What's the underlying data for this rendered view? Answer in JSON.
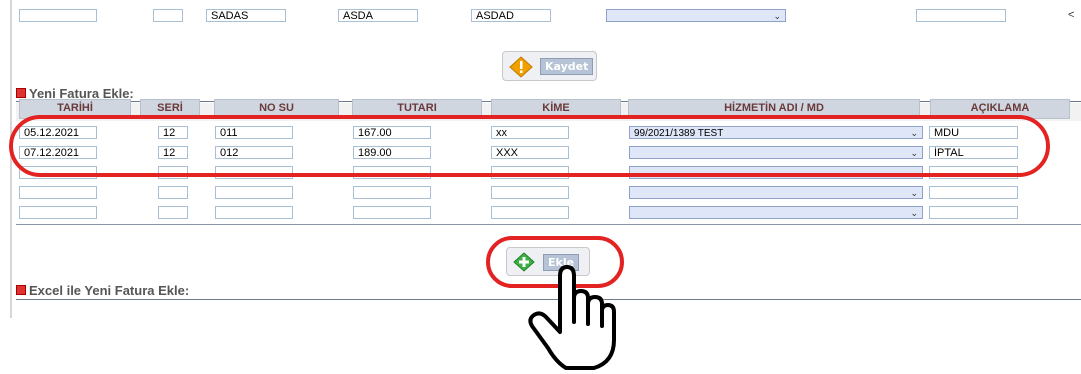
{
  "top_row": {
    "cells": [
      "",
      "",
      "SADAS",
      "ASDA",
      "ASDAD",
      "",
      ""
    ],
    "chevron": "⌄",
    "right_arrow": "<"
  },
  "kaydet_button": {
    "label": "Kaydet",
    "icon": "warning-diamond-icon",
    "icon_color": "#f0a000"
  },
  "yeni_fatura": {
    "title": "Yeni Fatura Ekle:",
    "headers": [
      "TARİHİ",
      "SERİ",
      "NO SU",
      "TUTARI",
      "KİME",
      "HİZMETİN ADI / MD",
      "AÇIKLAMA"
    ],
    "rows": [
      {
        "tarih": "05.12.2021",
        "seri": "12",
        "no": "011",
        "tutar": "167.00",
        "kime": "xx",
        "hizmet": "99/2021/1389 TEST",
        "aciklama": "MDU"
      },
      {
        "tarih": "07.12.2021",
        "seri": "12",
        "no": "012",
        "tutar": "189.00",
        "kime": "XXX",
        "hizmet": "",
        "aciklama": "İPTAL"
      },
      {
        "tarih": "",
        "seri": "",
        "no": "",
        "tutar": "",
        "kime": "",
        "hizmet": "",
        "aciklama": ""
      },
      {
        "tarih": "",
        "seri": "",
        "no": "",
        "tutar": "",
        "kime": "",
        "hizmet": "",
        "aciklama": ""
      },
      {
        "tarih": "",
        "seri": "",
        "no": "",
        "tutar": "",
        "kime": "",
        "hizmet": "",
        "aciklama": ""
      }
    ]
  },
  "ekle_button": {
    "label": "Ekle",
    "icon": "green-plus-diamond-icon",
    "icon_color": "#3cb043"
  },
  "excel_section": {
    "title": "Excel ile Yeni Fatura Ekle:"
  },
  "annotations": {
    "highlight_color": "#e32222",
    "pointer": "hand-pointer-icon"
  }
}
